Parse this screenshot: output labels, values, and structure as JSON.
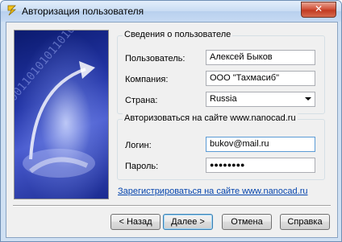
{
  "window": {
    "title": "Авторизация пользователя",
    "close_glyph": "✕"
  },
  "user_info": {
    "group_title": "Сведения о пользователе",
    "user_label": "Пользователь:",
    "user_value": "Алексей Быков",
    "company_label": "Компания:",
    "company_value": "ООО \"Тахмасиб\"",
    "country_label": "Страна:",
    "country_value": "Russia"
  },
  "auth": {
    "group_title": "Авторизоваться на сайте www.nanocad.ru",
    "login_label": "Логин:",
    "login_value": "bukov@mail.ru",
    "password_label": "Пароль:",
    "password_value": "●●●●●●●●"
  },
  "register_link": "Зарегистрироваться на сайте www.nanocad.ru",
  "buttons": {
    "back": "< Назад",
    "next": "Далее >",
    "cancel": "Отмена",
    "help": "Справка"
  },
  "banner": {
    "binary_text": "100110101011010010100110010101101001"
  }
}
